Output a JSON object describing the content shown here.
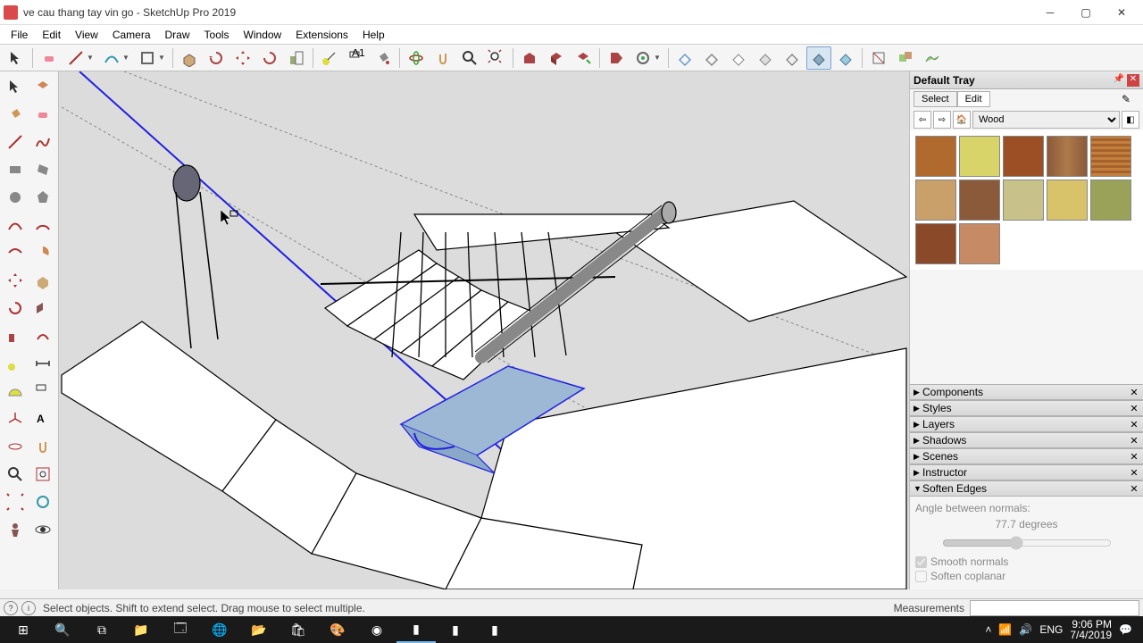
{
  "window": {
    "title": "ve cau thang tay vin go - SketchUp Pro 2019"
  },
  "menu": {
    "items": [
      "File",
      "Edit",
      "View",
      "Camera",
      "Draw",
      "Tools",
      "Window",
      "Extensions",
      "Help"
    ]
  },
  "tray": {
    "title": "Default Tray",
    "materials": {
      "tabs": {
        "select": "Select",
        "edit": "Edit"
      },
      "library": "Wood",
      "swatches": [
        "#b06a2e",
        "#d9d46a",
        "#9c4f24",
        "#ad7a4a",
        "#c47e3e",
        "#c9a06a",
        "#8a5a3a",
        "#c8c28a",
        "#d8c36a",
        "#9aa25a",
        "#8a4a2a",
        "#c68a64"
      ]
    },
    "panels": {
      "components": "Components",
      "styles": "Styles",
      "layers": "Layers",
      "shadows": "Shadows",
      "scenes": "Scenes",
      "instructor": "Instructor",
      "soften": "Soften Edges"
    },
    "soften": {
      "angle_label": "Angle between normals:",
      "value": "77.7",
      "unit": "degrees",
      "smooth": "Smooth normals",
      "coplanar": "Soften coplanar"
    }
  },
  "status": {
    "text": "Select objects. Shift to extend select. Drag mouse to select multiple.",
    "measurements_label": "Measurements"
  },
  "taskbar": {
    "lang": "ENG",
    "time": "9:06 PM",
    "date": "7/4/2019"
  }
}
